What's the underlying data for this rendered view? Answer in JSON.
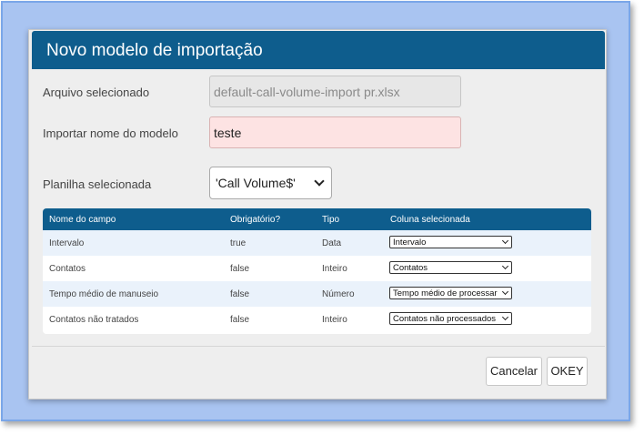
{
  "dialog": {
    "title": "Novo modelo de importação",
    "file_label": "Arquivo selecionado",
    "file_value": "default-call-volume-import pr.xlsx",
    "name_label": "Importar nome do modelo",
    "name_value": "teste",
    "sheet_label": "Planilha selecionada",
    "sheet_value": "'Call Volume$'"
  },
  "table": {
    "headers": [
      "Nome do campo",
      "Obrigatório?",
      "Tipo",
      "Coluna selecionada"
    ],
    "rows": [
      {
        "field": "Intervalo",
        "required": "true",
        "type": "Data",
        "column": "Intervalo"
      },
      {
        "field": "Contatos",
        "required": "false",
        "type": "Inteiro",
        "column": "Contatos"
      },
      {
        "field": "Tempo médio de manuseio",
        "required": "false",
        "type": "Número",
        "column": "Tempo médio de processar"
      },
      {
        "field": "Contatos não tratados",
        "required": "false",
        "type": "Inteiro",
        "column": "Contatos não processados"
      }
    ]
  },
  "buttons": {
    "cancel": "Cancelar",
    "ok": "OKEY"
  },
  "colors": {
    "header": "#0e5d8d",
    "frame": "#a9c4f1",
    "name_field_bg": "#fde3e3",
    "row_alt": "#eaf2fb"
  }
}
